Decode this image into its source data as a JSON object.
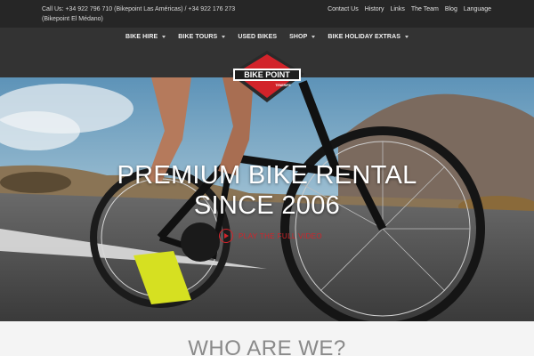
{
  "topbar": {
    "contact_line1": "Call Us:  +34 922 796 710 (Bikepoint Las Américas) / +34 922 176 273",
    "contact_line2": "(Bikepoint El Médano)",
    "links": [
      "Contact Us",
      "History",
      "Links",
      "The Team",
      "Blog",
      "Language"
    ]
  },
  "nav": {
    "items": [
      {
        "label": "BIKE HIRE",
        "dropdown": true
      },
      {
        "label": "BIKE TOURS",
        "dropdown": true
      },
      {
        "label": "USED BIKES",
        "dropdown": false
      },
      {
        "label": "SHOP",
        "dropdown": true
      },
      {
        "label": "BIKE HOLIDAY EXTRAS",
        "dropdown": true
      }
    ]
  },
  "logo": {
    "brand": "BIKE POINT",
    "sub": "TENERIFE",
    "colors": {
      "red": "#d2232a",
      "dark": "#2a2a2a"
    }
  },
  "hero": {
    "headline_line1": "PREMIUM BIKE RENTAL",
    "headline_line2": "SINCE 2006",
    "video_link": "PLAY THE FULL VIDEO",
    "play_icon": "play-circle-icon"
  },
  "section": {
    "title": "WHO ARE WE?"
  },
  "colors": {
    "topbar_bg": "#262626",
    "nav_bg": "#333333",
    "accent": "#d2232a"
  }
}
